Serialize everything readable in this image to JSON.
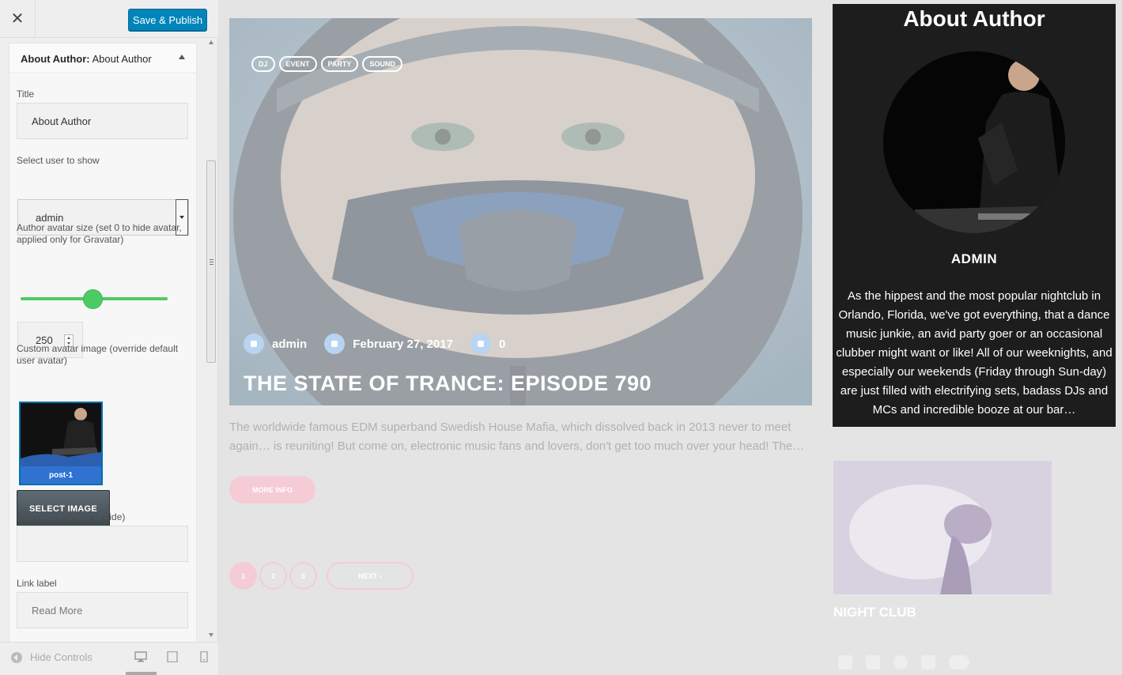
{
  "customizer": {
    "close_icon_glyph": "✕",
    "publish_label": "Save & Publish",
    "widget": {
      "title_prefix": "About Author:",
      "title_value": "About Author"
    },
    "fields": {
      "title_label": "Title",
      "title_value": "About Author",
      "user_label": "Select user to show",
      "user_value": "admin",
      "avatar_size_label": "Author avatar size (set 0 to hide avatar, applied only for Gravatar)",
      "avatar_size_value": "250",
      "custom_avatar_label": "Custom avatar image (override default user avatar)",
      "thumb_caption": "post-1",
      "select_image_label": "SELECT IMAGE",
      "link_label": "Link (leave empty to hide)",
      "link_value": "",
      "link_text_label": "Link label",
      "link_text_placeholder": "Read More"
    },
    "footer": {
      "hide_controls_label": "Hide Controls"
    },
    "accent_color": "#0085ba",
    "slider_color": "#4ccb64"
  },
  "preview": {
    "tags": [
      "DJ",
      "EVENT",
      "PARTY",
      "SOUND"
    ],
    "meta": {
      "author": "admin",
      "date": "February 27, 2017",
      "comments": "0"
    },
    "post_title": "THE STATE OF TRANCE: EPISODE 790",
    "excerpt": "The worldwide famous EDM superband Swedish House Mafia, which dissolved back in 2013 never to meet again… is reuniting! But come on, electronic music fans and lovers, don't get too much over your head! The…",
    "more_info_label": "MORE INFO",
    "pagination": {
      "pages": [
        "1",
        "2",
        "3"
      ],
      "next_label": "NEXT ›"
    },
    "author_widget": {
      "heading": "About Author",
      "name": "ADMIN",
      "bio": "As the hippest and the most popular nightclub in Orlando, Florida, we've got everything, that a dance music junkie, an avid party goer or an occasional clubber might want or like! All of our weeknights, and especially our weekends (Friday through Sun-day) are just filled with electrifying sets, badass DJs and MCs and incredible booze at our bar…"
    },
    "night_club_title": "NIGHT CLUB",
    "social_icons": [
      "facebook-icon",
      "twitter-icon",
      "pinterest-icon",
      "youtube-icon",
      "soundcloud-icon"
    ],
    "accent_pink": "#f5cbd6",
    "author_bg": "#1d1d1d"
  }
}
